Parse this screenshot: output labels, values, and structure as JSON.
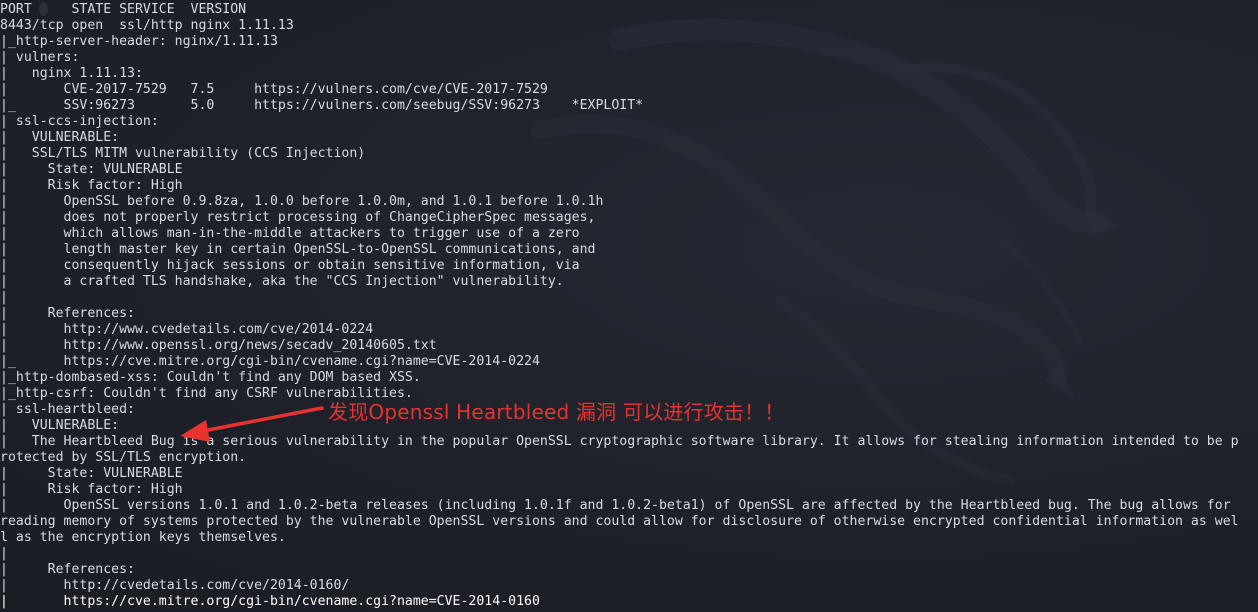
{
  "terminal": {
    "lines": [
      "PORT     STATE SERVICE  VERSION",
      "8443/tcp open  ssl/http nginx 1.11.13",
      "|_http-server-header: nginx/1.11.13",
      "| vulners:",
      "|   nginx 1.11.13:",
      "|       CVE-2017-7529   7.5     https://vulners.com/cve/CVE-2017-7529",
      "|_      SSV:96273       5.0     https://vulners.com/seebug/SSV:96273    *EXPLOIT*",
      "| ssl-ccs-injection:",
      "|   VULNERABLE:",
      "|   SSL/TLS MITM vulnerability (CCS Injection)",
      "|     State: VULNERABLE",
      "|     Risk factor: High",
      "|       OpenSSL before 0.9.8za, 1.0.0 before 1.0.0m, and 1.0.1 before 1.0.1h",
      "|       does not properly restrict processing of ChangeCipherSpec messages,",
      "|       which allows man-in-the-middle attackers to trigger use of a zero",
      "|       length master key in certain OpenSSL-to-OpenSSL communications, and",
      "|       consequently hijack sessions or obtain sensitive information, via",
      "|       a crafted TLS handshake, aka the \"CCS Injection\" vulnerability.",
      "|",
      "|     References:",
      "|       http://www.cvedetails.com/cve/2014-0224",
      "|       http://www.openssl.org/news/secadv_20140605.txt",
      "|_      https://cve.mitre.org/cgi-bin/cvename.cgi?name=CVE-2014-0224",
      "|_http-dombased-xss: Couldn't find any DOM based XSS.",
      "|_http-csrf: Couldn't find any CSRF vulnerabilities.",
      "| ssl-heartbleed:",
      "|   VULNERABLE:",
      "|   The Heartbleed Bug is a serious vulnerability in the popular OpenSSL cryptographic software library. It allows for stealing information intended to be p",
      "rotected by SSL/TLS encryption.",
      "|     State: VULNERABLE",
      "|     Risk factor: High",
      "|       OpenSSL versions 1.0.1 and 1.0.2-beta releases (including 1.0.1f and 1.0.2-beta1) of OpenSSL are affected by the Heartbleed bug. The bug allows for",
      "reading memory of systems protected by the vulnerable OpenSSL versions and could allow for disclosure of otherwise encrypted confidential information as wel",
      "l as the encryption keys themselves.",
      "|",
      "|     References:",
      "|       http://cvedetails.com/cve/2014-0160/",
      "|       https://cve.mitre.org/cgi-bin/cvename.cgi?name=CVE-2014-0160"
    ]
  },
  "annotation": {
    "text": "发现Openssl Heartbleed 漏洞 可以进行攻击！！",
    "color": "#e8322f"
  },
  "colors": {
    "background": "#1e2029",
    "foreground": "#d8dbe2"
  }
}
